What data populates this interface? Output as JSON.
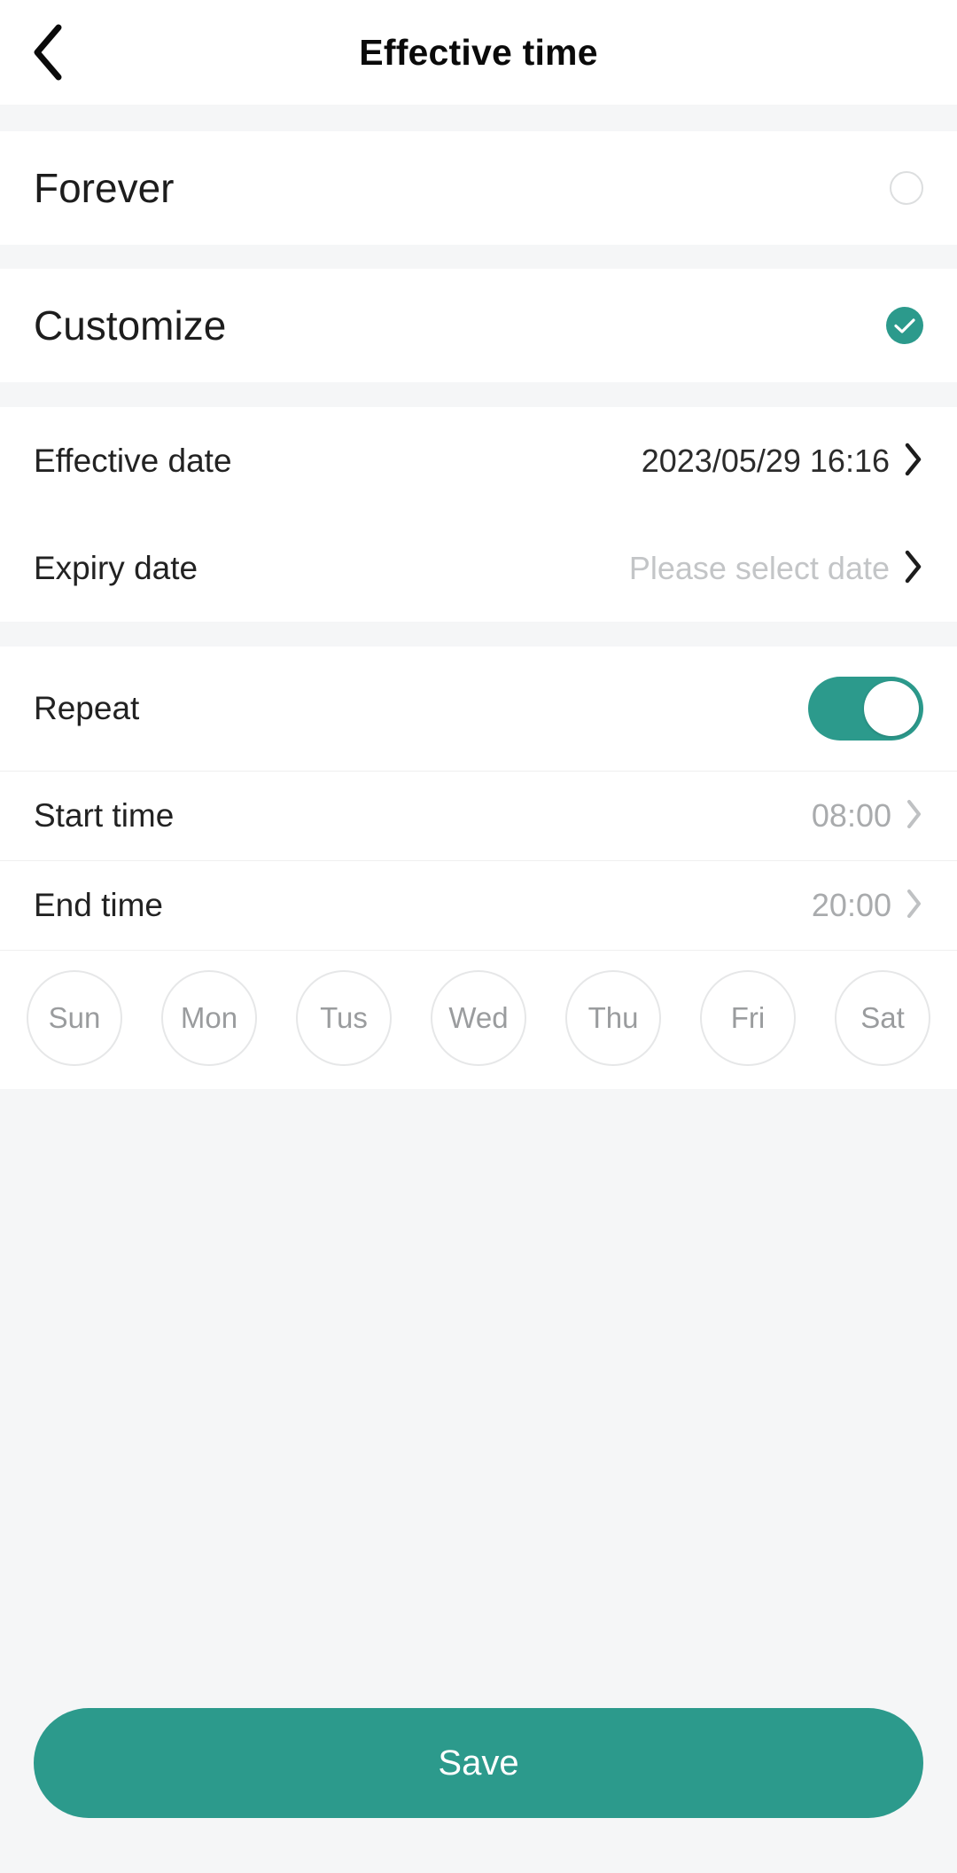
{
  "header": {
    "title": "Effective time",
    "back_icon": "chevron-left-icon"
  },
  "mode_options": [
    {
      "label": "Forever",
      "selected": false
    },
    {
      "label": "Customize",
      "selected": true
    }
  ],
  "date_section": {
    "effective": {
      "label": "Effective date",
      "value": "2023/05/29 16:16",
      "is_placeholder": false,
      "chevron": "chevron-right-icon"
    },
    "expiry": {
      "label": "Expiry date",
      "value": "Please select date",
      "is_placeholder": true,
      "chevron": "chevron-right-icon"
    }
  },
  "repeat_section": {
    "repeat": {
      "label": "Repeat",
      "enabled": true
    },
    "start_time": {
      "label": "Start time",
      "value": "08:00",
      "chevron": "chevron-right-icon"
    },
    "end_time": {
      "label": "End time",
      "value": "20:00",
      "chevron": "chevron-right-icon"
    },
    "days": [
      {
        "label": "Sun",
        "selected": false
      },
      {
        "label": "Mon",
        "selected": false
      },
      {
        "label": "Tus",
        "selected": false
      },
      {
        "label": "Wed",
        "selected": false
      },
      {
        "label": "Thu",
        "selected": false
      },
      {
        "label": "Fri",
        "selected": false
      },
      {
        "label": "Sat",
        "selected": false
      }
    ]
  },
  "footer": {
    "save_label": "Save"
  },
  "colors": {
    "accent": "#2c9a8c",
    "page_background": "#f5f6f7",
    "card_background": "#ffffff",
    "primary_text": "#222222",
    "muted_text": "#a9abad",
    "placeholder_text": "#c3c5c7"
  }
}
